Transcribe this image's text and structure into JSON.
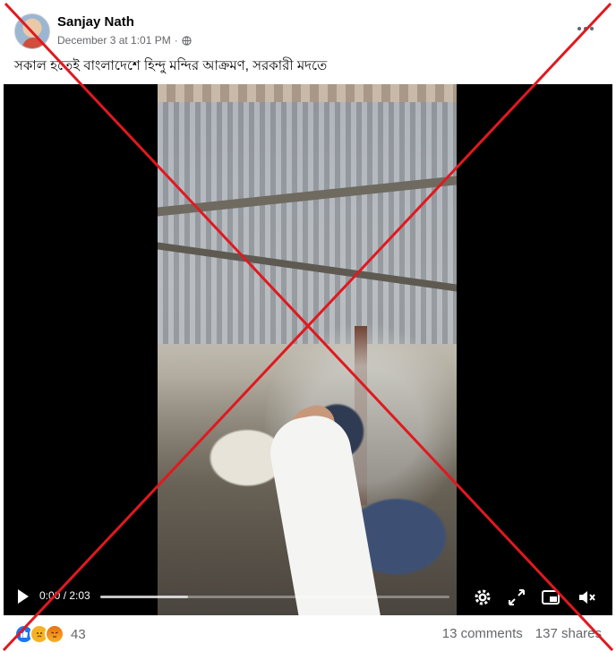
{
  "post": {
    "author": "Sanjay Nath",
    "timestamp": "December 3 at 1:01 PM",
    "separator": "·",
    "audience_icon": "globe-icon",
    "more_icon": "ellipsis-icon",
    "caption": "সকাল হতেই বাংলাদেশে হিন্দু মন্দির আক্রমণ, সরকারী মদতে"
  },
  "video": {
    "time": "0:00 / 2:03",
    "progress_fraction": 0.0,
    "buffered_fraction": 0.25,
    "icons": [
      "play-icon",
      "settings-icon",
      "fullscreen-icon",
      "picture-in-picture-icon",
      "mute-icon"
    ]
  },
  "footer": {
    "reactions": [
      "like",
      "sad",
      "angry"
    ],
    "reaction_count": "43",
    "comments": "13 comments",
    "shares": "137 shares"
  },
  "overlay": {
    "cross_color": "#e0191f",
    "accent": "#1877f2"
  }
}
